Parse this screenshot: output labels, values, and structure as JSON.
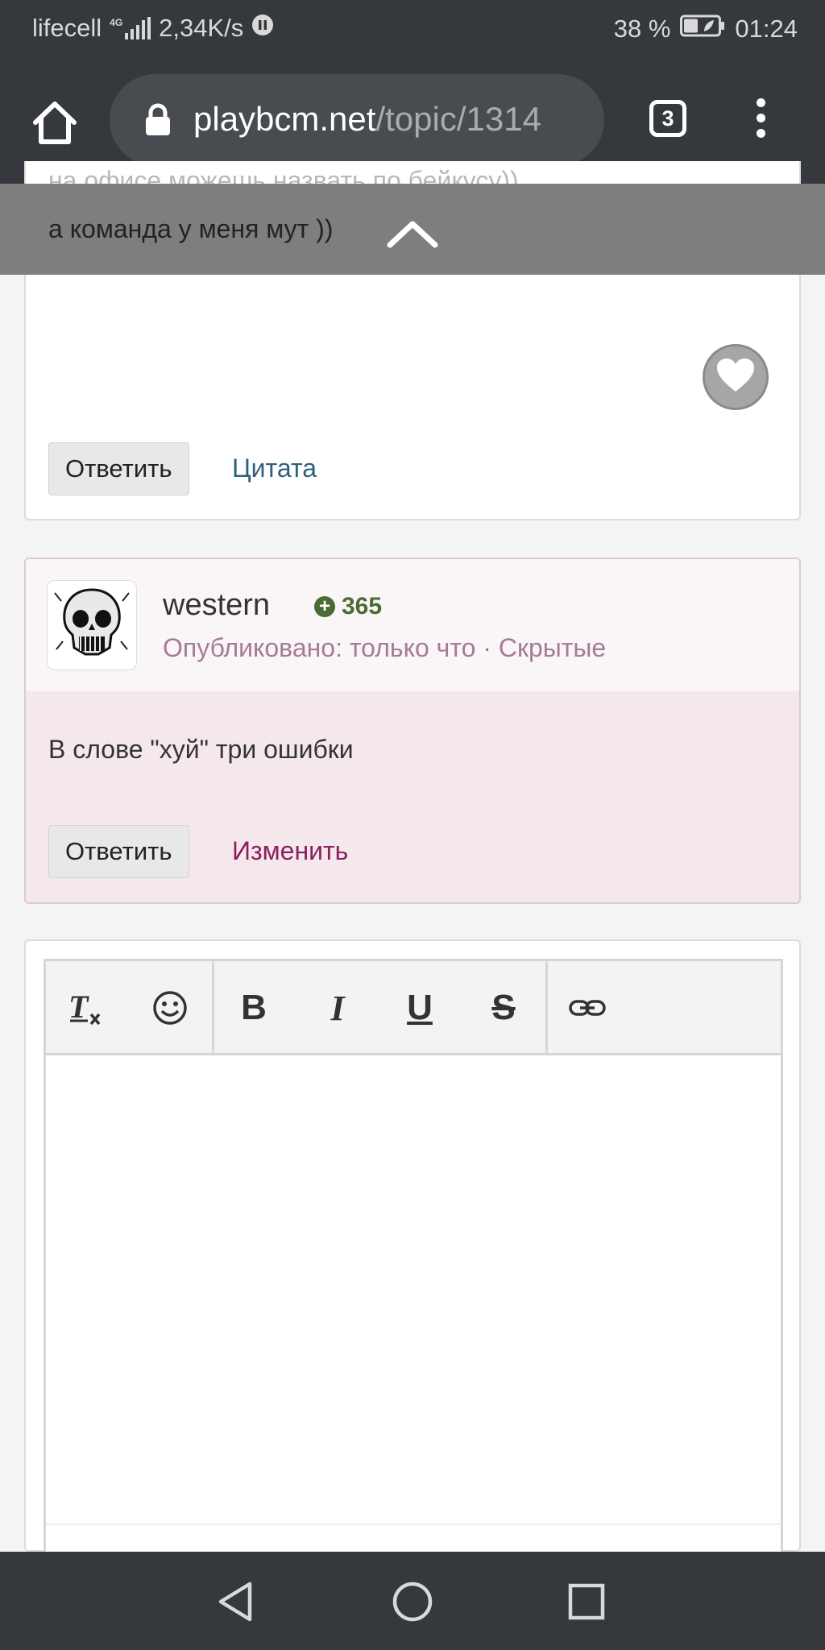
{
  "status_bar": {
    "carrier": "lifecell",
    "network_type": "4G",
    "speed": "2,34K/s",
    "battery": "38 %",
    "time": "01:24"
  },
  "browser": {
    "url_host": "playbcm.net",
    "url_path": "/topic/1314",
    "tab_count": "3"
  },
  "previous_post": {
    "line1": "на офисе можешь назвать по бейкусу))",
    "line2": "а команда у меня мут ))",
    "reply_label": "Ответить",
    "quote_label": "Цитата"
  },
  "post": {
    "author": "western",
    "reputation": "365",
    "meta": "Опубликовано: только что · Скрытые",
    "body": "В слове \"хуй\" три ошибки",
    "reply_label": "Ответить",
    "edit_label": "Изменить"
  },
  "editor": {
    "toolbar": [
      "remove-format",
      "emoji",
      "bold",
      "italic",
      "underline",
      "strikethrough",
      "link"
    ]
  },
  "colors": {
    "browser_chrome": "#35383c",
    "link_blue": "#2f5f7f",
    "link_magenta": "#8d1e5f",
    "meta_pink": "#a57b96",
    "reputation_green": "#4a6b32",
    "post_bg": "#f5e8ed"
  }
}
